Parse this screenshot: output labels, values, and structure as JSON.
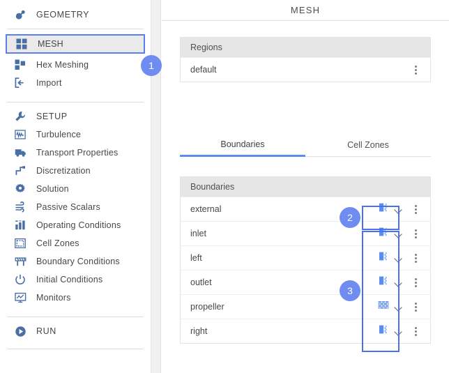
{
  "header": {
    "title": "MESH"
  },
  "sidebar": {
    "items": [
      {
        "label": "GEOMETRY",
        "icon": "geometry-icon",
        "type": "section",
        "selected": false
      },
      {
        "label": "MESH",
        "icon": "mesh-grid-icon",
        "type": "item",
        "selected": true
      },
      {
        "label": "Hex Meshing",
        "icon": "hex-mesh-icon",
        "type": "item",
        "selected": false
      },
      {
        "label": "Import",
        "icon": "import-icon",
        "type": "item",
        "selected": false
      },
      {
        "label": "SETUP",
        "icon": "wrench-icon",
        "type": "section",
        "selected": false
      },
      {
        "label": "Turbulence",
        "icon": "turbulence-wave-icon",
        "type": "item",
        "selected": false
      },
      {
        "label": "Transport Properties",
        "icon": "truck-icon",
        "type": "item",
        "selected": false
      },
      {
        "label": "Discretization",
        "icon": "discretization-steps-icon",
        "type": "item",
        "selected": false
      },
      {
        "label": "Solution",
        "icon": "gear-icon",
        "type": "item",
        "selected": false
      },
      {
        "label": "Passive Scalars",
        "icon": "passive-scalars-wind-icon",
        "type": "item",
        "selected": false
      },
      {
        "label": "Operating Conditions",
        "icon": "bar-chart-icon",
        "type": "item",
        "selected": false
      },
      {
        "label": "Cell Zones",
        "icon": "dashed-square-icon",
        "type": "item",
        "selected": false
      },
      {
        "label": "Boundary Conditions",
        "icon": "barrier-icon",
        "type": "item",
        "selected": false
      },
      {
        "label": "Initial Conditions",
        "icon": "power-icon",
        "type": "item",
        "selected": false
      },
      {
        "label": "Monitors",
        "icon": "monitor-chart-icon",
        "type": "item",
        "selected": false
      },
      {
        "label": "RUN",
        "icon": "play-circle-icon",
        "type": "section",
        "selected": false
      }
    ]
  },
  "regions_panel": {
    "header": "Regions",
    "rows": [
      {
        "name": "default",
        "menu_icon": "kebab-menu-icon"
      }
    ]
  },
  "tabs": [
    {
      "label": "Boundaries",
      "active": true
    },
    {
      "label": "Cell Zones",
      "active": false
    }
  ],
  "boundaries_panel": {
    "header": "Boundaries",
    "rows": [
      {
        "name": "external",
        "type_icon": "patch-boundary-icon",
        "chevron": "chevron-down-icon",
        "menu_icon": "kebab-menu-icon"
      },
      {
        "name": "inlet",
        "type_icon": "patch-boundary-icon",
        "chevron": "chevron-down-icon",
        "menu_icon": "kebab-menu-icon"
      },
      {
        "name": "left",
        "type_icon": "patch-boundary-icon",
        "chevron": "chevron-down-icon",
        "menu_icon": "kebab-menu-icon"
      },
      {
        "name": "outlet",
        "type_icon": "patch-boundary-icon",
        "chevron": "chevron-down-icon",
        "menu_icon": "kebab-menu-icon"
      },
      {
        "name": "propeller",
        "type_icon": "wall-brick-icon",
        "chevron": "chevron-down-icon",
        "menu_icon": "kebab-menu-icon"
      },
      {
        "name": "right",
        "type_icon": "patch-boundary-icon",
        "chevron": "chevron-down-icon",
        "menu_icon": "kebab-menu-icon"
      }
    ]
  },
  "callouts": [
    {
      "number": "1",
      "target": "sidebar-item-mesh"
    },
    {
      "number": "2",
      "target": "boundary-type-external"
    },
    {
      "number": "3",
      "target": "boundary-type-column"
    }
  ],
  "colors": {
    "accent": "#5b8def",
    "badge": "#6f8cf0",
    "highlight": "#4a6ff0",
    "icon_blue": "#4a6fa5",
    "panel_header": "#e6e6e6",
    "selected_row": "#eaeaea"
  }
}
